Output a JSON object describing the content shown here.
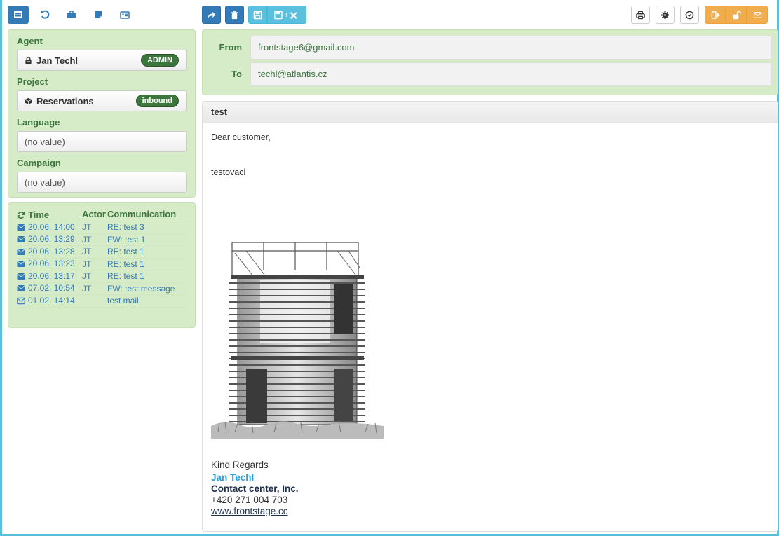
{
  "toolbar": {
    "nav_icons": [
      "list-icon",
      "history-icon",
      "briefcase-icon",
      "note-icon",
      "contact-card-icon"
    ],
    "actions": [
      "forward-icon",
      "trash-icon",
      "save-icon",
      "save-close-icon"
    ],
    "right": [
      "print-icon",
      "gear-icon",
      "check-circle-icon",
      "logout-icon",
      "unlock-icon",
      "envelope-icon"
    ]
  },
  "sidebar": {
    "agent_label": "Agent",
    "agent_name": "Jan Techl",
    "agent_badge": "ADMIN",
    "project_label": "Project",
    "project_name": "Reservations",
    "project_badge": "inbound",
    "language_label": "Language",
    "language_value": "(no value)",
    "campaign_label": "Campaign",
    "campaign_value": "(no value)"
  },
  "history": {
    "col_time": "Time",
    "col_actor": "Actor",
    "col_comm": "Communication",
    "rows": [
      {
        "time": "20.06. 14:00",
        "actor": "JT",
        "comm": "RE: test 3"
      },
      {
        "time": "20.06. 13:29",
        "actor": "JT",
        "comm": "FW: test 1"
      },
      {
        "time": "20.06. 13:28",
        "actor": "JT",
        "comm": "RE: test 1"
      },
      {
        "time": "20.06. 13:23",
        "actor": "JT",
        "comm": "RE: test 1"
      },
      {
        "time": "20.06. 13:17",
        "actor": "JT",
        "comm": "RE: test 1"
      },
      {
        "time": "07.02. 10:54",
        "actor": "JT",
        "comm": "FW: test message"
      },
      {
        "time": "01.02. 14:14",
        "actor": "",
        "comm": "test mail"
      }
    ]
  },
  "email": {
    "from_label": "From",
    "from_value": "frontstage6@gmail.com",
    "to_label": "To",
    "to_value": "techl@atlantis.cz",
    "subject": "test",
    "greeting": "Dear customer,",
    "body": "testovaci",
    "closing": "Kind Regards",
    "sig_name": "Jan Techl",
    "sig_company": "Contact center, Inc.",
    "sig_phone": "+420 271 004 703",
    "sig_web": "www.frontstage.cc"
  },
  "colors": {
    "primary": "#337ab7",
    "info": "#5bc0de",
    "warning": "#f0ad4e",
    "panel_green": "#d6ebc7",
    "text_green": "#3c763d"
  }
}
